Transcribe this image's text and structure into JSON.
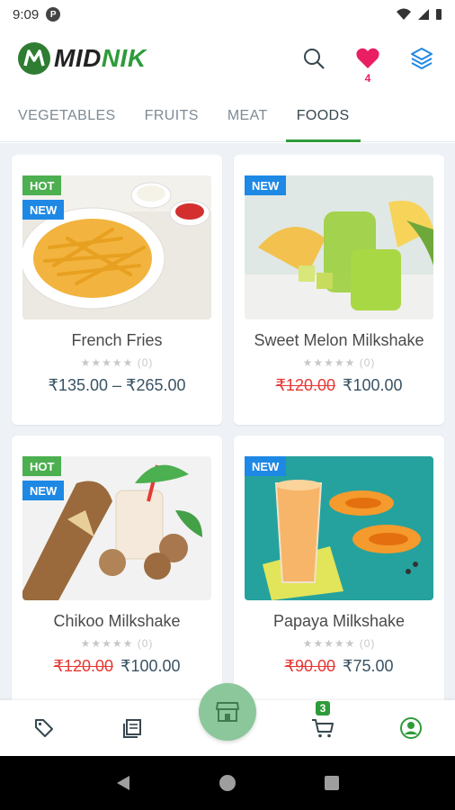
{
  "status": {
    "time": "9:09",
    "app_icon_letter": "P"
  },
  "header": {
    "logo_a": "MID",
    "logo_b": "NIK",
    "wishlist_count": "4",
    "icons": [
      "search-icon",
      "heart-icon",
      "layers-icon"
    ]
  },
  "tabs": [
    {
      "label": "VEGETABLES",
      "active": false
    },
    {
      "label": "FRUITS",
      "active": false
    },
    {
      "label": "MEAT",
      "active": false
    },
    {
      "label": "FOODS",
      "active": true
    }
  ],
  "products": [
    {
      "name": "French Fries",
      "rating": "★★★★★ (0)",
      "price_old": "",
      "price": "₹135.00 – ₹265.00",
      "badges": [
        "HOT",
        "NEW"
      ]
    },
    {
      "name": "Sweet Melon Milkshake",
      "rating": "★★★★★ (0)",
      "price_old": "₹120.00",
      "price": "₹100.00",
      "badges": [
        "NEW"
      ]
    },
    {
      "name": "Chikoo Milkshake",
      "rating": "★★★★★ (0)",
      "price_old": "₹120.00",
      "price": "₹100.00",
      "badges": [
        "HOT",
        "NEW"
      ]
    },
    {
      "name": "Papaya Milkshake",
      "rating": "★★★★★ (0)",
      "price_old": "₹90.00",
      "price": "₹75.00",
      "badges": [
        "NEW"
      ]
    }
  ],
  "bottom_nav": {
    "cart_count": "3",
    "icons": [
      "tag-icon",
      "orders-icon",
      "store-icon",
      "cart-icon",
      "account-icon"
    ]
  },
  "colors": {
    "accent": "#2e9b3a",
    "hot": "#4caf50",
    "new": "#1e88e5",
    "sale": "#e53935",
    "heart": "#e91e63"
  }
}
